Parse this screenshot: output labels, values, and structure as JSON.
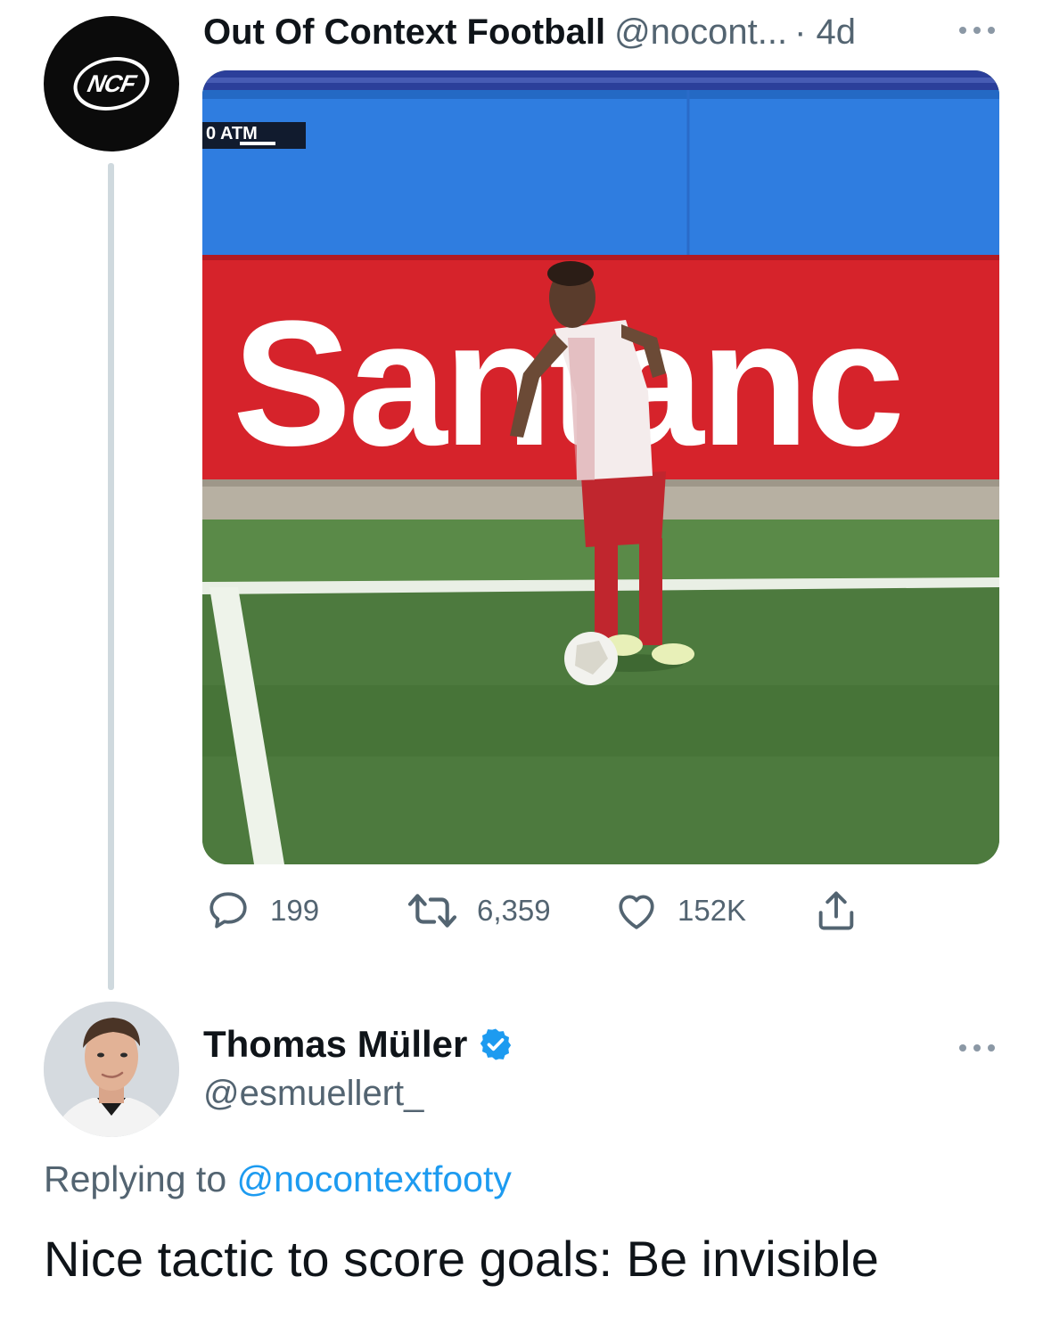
{
  "original_tweet": {
    "avatar_logo_text": "NCF",
    "display_name": "Out Of Context Football",
    "handle": "@nocont...",
    "time": "· 4d",
    "more_icon": "more-horizontal-icon",
    "media": {
      "scoreboard_text": "0 ATM",
      "ad_board_text": "Santanc"
    },
    "actions": {
      "replies": "199",
      "retweets": "6,359",
      "likes": "152K",
      "share_icon": "share-icon"
    }
  },
  "reply_tweet": {
    "display_name": "Thomas Müller",
    "verified": true,
    "handle": "@esmuellert_",
    "replying_to_label": "Replying to",
    "replying_to_handle": "@nocontextfooty",
    "text": "Nice tactic to score goals: Be invisible",
    "more_icon": "more-horizontal-icon"
  },
  "colors": {
    "text_primary": "#0f1419",
    "text_secondary": "#536471",
    "link": "#1d9bf0",
    "thread_line": "#cfd9de"
  }
}
